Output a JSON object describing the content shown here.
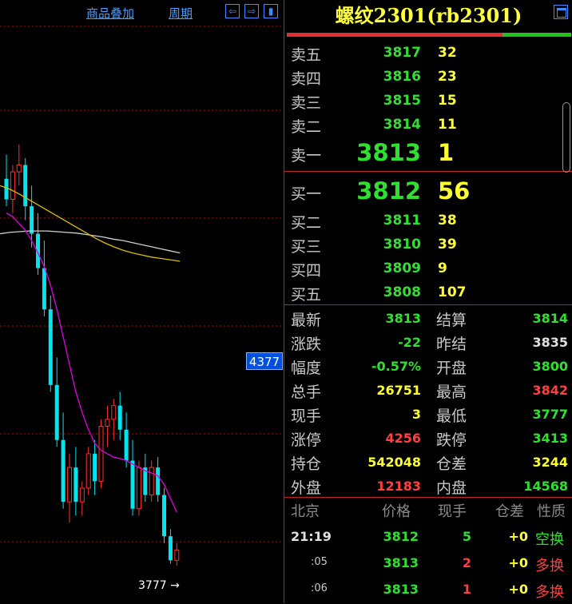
{
  "chart": {
    "overlay_label": "商品叠加",
    "period_label": "周期",
    "price_tag": "4377",
    "low_label": "3777",
    "colors": {
      "up": "#ff3030",
      "down": "#00e5ee",
      "ma_short": "#e000e0",
      "ma_mid": "#d8c000",
      "ma_long": "#d0d0d0",
      "grid": "#c00000"
    },
    "candles": [
      {
        "o": 4340,
        "h": 4375,
        "l": 4300,
        "c": 4310
      },
      {
        "o": 4310,
        "h": 4360,
        "l": 4290,
        "c": 4350
      },
      {
        "o": 4350,
        "h": 4390,
        "l": 4330,
        "c": 4360
      },
      {
        "o": 4360,
        "h": 4370,
        "l": 4280,
        "c": 4300
      },
      {
        "o": 4300,
        "h": 4330,
        "l": 4240,
        "c": 4260
      },
      {
        "o": 4260,
        "h": 4290,
        "l": 4200,
        "c": 4210
      },
      {
        "o": 4210,
        "h": 4250,
        "l": 4140,
        "c": 4150
      },
      {
        "o": 4150,
        "h": 4170,
        "l": 4030,
        "c": 4040
      },
      {
        "o": 4040,
        "h": 4080,
        "l": 3950,
        "c": 3960
      },
      {
        "o": 3960,
        "h": 4000,
        "l": 3860,
        "c": 3870
      },
      {
        "o": 3870,
        "h": 3940,
        "l": 3840,
        "c": 3920
      },
      {
        "o": 3920,
        "h": 3950,
        "l": 3850,
        "c": 3870
      },
      {
        "o": 3870,
        "h": 3900,
        "l": 3850,
        "c": 3890
      },
      {
        "o": 3890,
        "h": 3950,
        "l": 3880,
        "c": 3940
      },
      {
        "o": 3940,
        "h": 3960,
        "l": 3880,
        "c": 3900
      },
      {
        "o": 3900,
        "h": 3990,
        "l": 3890,
        "c": 3980
      },
      {
        "o": 3980,
        "h": 4010,
        "l": 3950,
        "c": 3990
      },
      {
        "o": 3990,
        "h": 4020,
        "l": 3960,
        "c": 4010
      },
      {
        "o": 4010,
        "h": 4030,
        "l": 3960,
        "c": 3975
      },
      {
        "o": 3975,
        "h": 4000,
        "l": 3920,
        "c": 3930
      },
      {
        "o": 3930,
        "h": 3960,
        "l": 3850,
        "c": 3860
      },
      {
        "o": 3860,
        "h": 3930,
        "l": 3850,
        "c": 3920
      },
      {
        "o": 3920,
        "h": 3940,
        "l": 3870,
        "c": 3880
      },
      {
        "o": 3880,
        "h": 3930,
        "l": 3870,
        "c": 3920
      },
      {
        "o": 3920,
        "h": 3935,
        "l": 3870,
        "c": 3880
      },
      {
        "o": 3880,
        "h": 3890,
        "l": 3810,
        "c": 3820
      },
      {
        "o": 3820,
        "h": 3830,
        "l": 3780,
        "c": 3785
      },
      {
        "o": 3785,
        "h": 3810,
        "l": 3777,
        "c": 3800
      }
    ],
    "ma_short": [
      4290,
      4285,
      4275,
      4265,
      4250,
      4232,
      4212,
      4185,
      4150,
      4110,
      4070,
      4030,
      4000,
      3975,
      3955,
      3945,
      3940,
      3935,
      3933,
      3930,
      3925,
      3920,
      3915,
      3912,
      3908,
      3895,
      3875,
      3855
    ],
    "ma_mid": [
      4330,
      4325,
      4318,
      4310,
      4302,
      4294,
      4286,
      4278,
      4270,
      4262,
      4254,
      4247,
      4241,
      4236,
      4232,
      4229,
      4226,
      4224,
      4222,
      4220
    ],
    "ma_long": [
      4260,
      4262,
      4263,
      4264,
      4264,
      4264,
      4263,
      4262,
      4261,
      4259,
      4257,
      4255,
      4252,
      4250,
      4247,
      4244,
      4241,
      4238,
      4235,
      4232
    ]
  },
  "panel": {
    "title": "螺纹2301(rb2301)",
    "asks": [
      {
        "label": "卖五",
        "price": "3817",
        "vol": "32"
      },
      {
        "label": "卖四",
        "price": "3816",
        "vol": "23"
      },
      {
        "label": "卖三",
        "price": "3815",
        "vol": "15"
      },
      {
        "label": "卖二",
        "price": "3814",
        "vol": "11"
      },
      {
        "label": "卖一",
        "price": "3813",
        "vol": "1"
      }
    ],
    "bids": [
      {
        "label": "买一",
        "price": "3812",
        "vol": "56"
      },
      {
        "label": "买二",
        "price": "3811",
        "vol": "38"
      },
      {
        "label": "买三",
        "price": "3810",
        "vol": "39"
      },
      {
        "label": "买四",
        "price": "3809",
        "vol": "9"
      },
      {
        "label": "买五",
        "price": "3808",
        "vol": "107"
      }
    ],
    "stats": [
      {
        "l1": "最新",
        "v1": "3813",
        "c1": "#30e030",
        "l2": "结算",
        "v2": "3814",
        "c2": "#30e030"
      },
      {
        "l1": "涨跌",
        "v1": "-22",
        "c1": "#30e030",
        "l2": "昨结",
        "v2": "3835",
        "c2": "#e0e0e0"
      },
      {
        "l1": "幅度",
        "v1": "-0.57%",
        "c1": "#30e030",
        "l2": "开盘",
        "v2": "3800",
        "c2": "#30e030"
      },
      {
        "l1": "总手",
        "v1": "26751",
        "c1": "#ffff30",
        "l2": "最高",
        "v2": "3842",
        "c2": "#ff4040"
      },
      {
        "l1": "现手",
        "v1": "3",
        "c1": "#ffff30",
        "l2": "最低",
        "v2": "3777",
        "c2": "#30e030"
      },
      {
        "l1": "涨停",
        "v1": "4256",
        "c1": "#ff4040",
        "l2": "跌停",
        "v2": "3413",
        "c2": "#30e030"
      },
      {
        "l1": "持仓",
        "v1": "542048",
        "c1": "#ffff30",
        "l2": "仓差",
        "v2": "3244",
        "c2": "#ffff30"
      },
      {
        "l1": "外盘",
        "v1": "12183",
        "c1": "#ff4040",
        "l2": "内盘",
        "v2": "14568",
        "c2": "#30e030"
      }
    ],
    "tick_headers": {
      "time": "北京",
      "price": "价格",
      "vol": "现手",
      "diff": "仓差",
      "nature": "性质"
    },
    "ticks": [
      {
        "time": "21:19",
        "price": "3812",
        "vol": "5",
        "vol_color": "#30e030",
        "diff": "+0",
        "nature": "空换",
        "nature_color": "#30e030"
      },
      {
        "time": ":05",
        "price": "3813",
        "vol": "2",
        "vol_color": "#ff4040",
        "diff": "+0",
        "nature": "多换",
        "nature_color": "#ff4040"
      },
      {
        "time": ":06",
        "price": "3813",
        "vol": "1",
        "vol_color": "#ff4040",
        "diff": "+0",
        "nature": "多换",
        "nature_color": "#ff4040"
      }
    ]
  }
}
